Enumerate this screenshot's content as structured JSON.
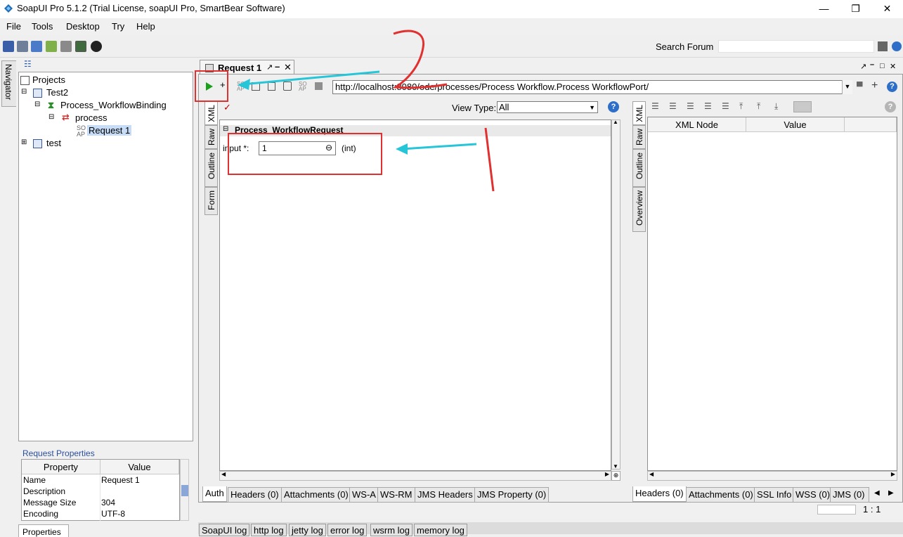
{
  "window": {
    "title": "SoapUI Pro 5.1.2 (Trial License, soapUI Pro, SmartBear Software)"
  },
  "menu": [
    "File",
    "Tools",
    "Desktop",
    "Try",
    "Help"
  ],
  "toolbar": {
    "search_label": "Search Forum",
    "search_value": ""
  },
  "navigator": {
    "tab_label": "Navigator",
    "root": "Projects",
    "nodes": [
      "Test2",
      "Process_WorkflowBinding",
      "process",
      "Request 1",
      "test"
    ]
  },
  "request_properties": {
    "title": "Request Properties",
    "columns": [
      "Property",
      "Value"
    ],
    "rows": [
      {
        "name": "Name",
        "value": "Request 1"
      },
      {
        "name": "Description",
        "value": ""
      },
      {
        "name": "Message Size",
        "value": "304"
      },
      {
        "name": "Encoding",
        "value": "UTF-8"
      }
    ],
    "tab": "Properties"
  },
  "editor": {
    "tab_title": "Request 1",
    "url": "http://localhost:8080/ode/processes/Process Workflow.Process WorkflowPort/",
    "view_type_label": "View Type:",
    "view_type_value": "All",
    "left_vtabs": [
      "XML",
      "Raw",
      "Outline",
      "Form"
    ],
    "right_vtabs": [
      "XML",
      "Raw",
      "Outline",
      "Overview"
    ],
    "form_section": "Process_WorkflowRequest",
    "input_label": "input *:",
    "input_value": "1",
    "input_type": "(int)",
    "right_columns": [
      "XML Node",
      "Value"
    ],
    "left_bottom_tabs": [
      "Auth",
      "Headers (0)",
      "Attachments (0)",
      "WS-A",
      "WS-RM",
      "JMS Headers",
      "JMS Property (0)"
    ],
    "right_bottom_tabs": [
      "Headers (0)",
      "Attachments (0)",
      "SSL Info",
      "WSS (0)",
      "JMS (0)"
    ],
    "cursor_pos": "1 : 1"
  },
  "log_tabs": [
    "SoapUI log",
    "http log",
    "jetty log",
    "error log",
    "wsrm log",
    "memory log"
  ]
}
